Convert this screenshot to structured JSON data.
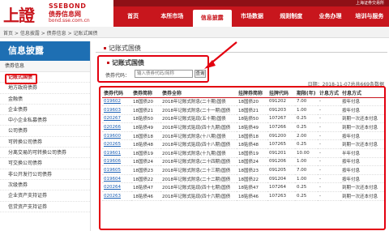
{
  "header": {
    "logo_mark": "上證",
    "logo_en": "SSEBOND",
    "logo_cn": "债券信息网",
    "logo_url": "bond.sse.com.cn",
    "top_link": "上海证券交易所",
    "nav": [
      "首页",
      "本所市场",
      "信息披露",
      "市场数据",
      "规则制度",
      "业务办理",
      "培训与服务"
    ],
    "active_nav": 2
  },
  "breadcrumb": "首页 > 信息披露 > 债券信息 > 记账式国债",
  "sidebar": {
    "title": "信息披露",
    "subtitle": "债券信息",
    "items": [
      "记账式国债",
      "地方政府债券",
      "金融债",
      "企业债券",
      "中小企业私募债券",
      "公司债券",
      "可转换公司债券",
      "分离交易的可转换公司债券",
      "可交换公司债券",
      "非公开发行公司债券",
      "次级债券",
      "企业资产支持证券",
      "信贷资产支持证券"
    ]
  },
  "main": {
    "page_title": "记账式国债",
    "panel_title": "记账式国债",
    "search_label": "债券代码：",
    "search_placeholder": "输入债券代码/简称",
    "search_button": "查询",
    "date_line": "日期：2018-11-07总共669条数据"
  },
  "table": {
    "headers": [
      "债券代码",
      "债券简称",
      "债券全称",
      "挂牌券简称",
      "挂牌代码",
      "期限(年)",
      "计息方式",
      "付息方式"
    ],
    "rows": [
      [
        "019602",
        "18国债20",
        "2018年记账式附息(二十期)国债",
        "18国债20",
        "091202",
        "7.00",
        "-",
        "按年付息"
      ],
      [
        "019603",
        "18国债21",
        "2018年记账式附息(二十一期)国债",
        "18国债21",
        "091203",
        "1.00",
        "-",
        "按年付息"
      ],
      [
        "020267",
        "18贴债50",
        "2018年记账式贴现(五十期)国债",
        "18贴债50",
        "107267",
        "0.25",
        "-",
        "到期一次还本付息"
      ],
      [
        "020266",
        "18贴债49",
        "2018年记账式贴现(四十九期)国债",
        "18贴债49",
        "107266",
        "0.25",
        "-",
        "到期一次还本付息"
      ],
      [
        "019600",
        "18国债18",
        "2018年记账式附息(十八期)国债",
        "18国债18",
        "091200",
        "2.00",
        "-",
        "按年付息"
      ],
      [
        "020265",
        "18贴债48",
        "2018年记账式贴现(四十八期)国债",
        "18贴债48",
        "107265",
        "0.25",
        "-",
        "到期一次还本付息"
      ],
      [
        "019601",
        "18国债19",
        "2018年记账式附息(十九期)国债",
        "18国债19",
        "091201",
        "10.00",
        "-",
        "半年付息"
      ],
      [
        "019606",
        "18国债24",
        "2018年记账式附息(二十四期)国债",
        "18国债24",
        "091206",
        "1.00",
        "-",
        "按年付息"
      ],
      [
        "019605",
        "18国债23",
        "2018年记账式附息(二十三期)国债",
        "18国债23",
        "091205",
        "7.00",
        "-",
        "按年付息"
      ],
      [
        "019604",
        "18国债22",
        "2018年记账式附息(二十二期)国债",
        "18国债22",
        "091204",
        "1.00",
        "-",
        "按年付息"
      ],
      [
        "020264",
        "18贴债47",
        "2018年记账式贴现(四十七期)国债",
        "18贴债47",
        "107264",
        "0.25",
        "-",
        "到期一次还本付息"
      ],
      [
        "020263",
        "18贴债46",
        "2018年记账式贴现(四十六期)国债",
        "18贴债46",
        "107263",
        "0.25",
        "-",
        "到期一次还本付息"
      ]
    ]
  },
  "colors": {
    "brand_red": "#c8161d",
    "sidebar_blue": "#1e6fb3",
    "highlight_red": "#e3000f",
    "link_blue": "#1a5fb4"
  }
}
